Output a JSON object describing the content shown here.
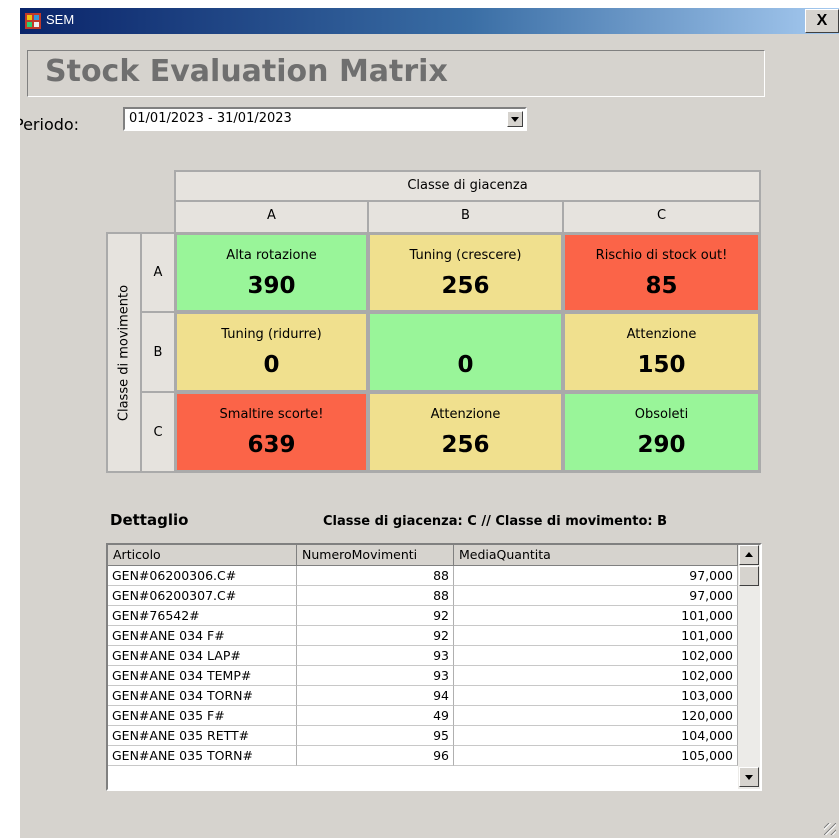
{
  "window": {
    "title": "SEM",
    "close_label": "X"
  },
  "header": {
    "title": "Stock Evaluation Matrix"
  },
  "periodo": {
    "label": "Periodo:",
    "value": "01/01/2023 - 31/01/2023"
  },
  "matrix": {
    "col_header": "Classe di giacenza",
    "row_header": "Classe di movimento",
    "cols": [
      "A",
      "B",
      "C"
    ],
    "rows": [
      "A",
      "B",
      "C"
    ],
    "cells": [
      [
        {
          "label": "Alta rotazione",
          "value": "390",
          "color": "#99f599"
        },
        {
          "label": "Tuning (crescere)",
          "value": "256",
          "color": "#f0e08e"
        },
        {
          "label": "Rischio di stock out!",
          "value": "85",
          "color": "#fb6448"
        }
      ],
      [
        {
          "label": "Tuning (ridurre)",
          "value": "0",
          "color": "#f0e08e"
        },
        {
          "label": "",
          "value": "0",
          "color": "#99f599"
        },
        {
          "label": "Attenzione",
          "value": "150",
          "color": "#f0e08e"
        }
      ],
      [
        {
          "label": "Smaltire scorte!",
          "value": "639",
          "color": "#fb6448"
        },
        {
          "label": "Attenzione",
          "value": "256",
          "color": "#f0e08e"
        },
        {
          "label": "Obsoleti",
          "value": "290",
          "color": "#99f599"
        }
      ]
    ]
  },
  "detail": {
    "title": "Dettaglio",
    "subtitle": "Classe di giacenza: C // Classe di movimento: B",
    "columns": [
      "Articolo",
      "NumeroMovimenti",
      "MediaQuantita"
    ],
    "rows": [
      [
        "GEN#06200306.C#",
        "88",
        "97,000"
      ],
      [
        "GEN#06200307.C#",
        "88",
        "97,000"
      ],
      [
        "GEN#76542#",
        "92",
        "101,000"
      ],
      [
        "GEN#ANE 034 F#",
        "92",
        "101,000"
      ],
      [
        "GEN#ANE 034 LAP#",
        "93",
        "102,000"
      ],
      [
        "GEN#ANE 034 TEMP#",
        "93",
        "102,000"
      ],
      [
        "GEN#ANE 034 TORN#",
        "94",
        "103,000"
      ],
      [
        "GEN#ANE 035 F#",
        "49",
        "120,000"
      ],
      [
        "GEN#ANE 035 RETT#",
        "95",
        "104,000"
      ],
      [
        "GEN#ANE 035 TORN#",
        "96",
        "105,000"
      ]
    ]
  }
}
